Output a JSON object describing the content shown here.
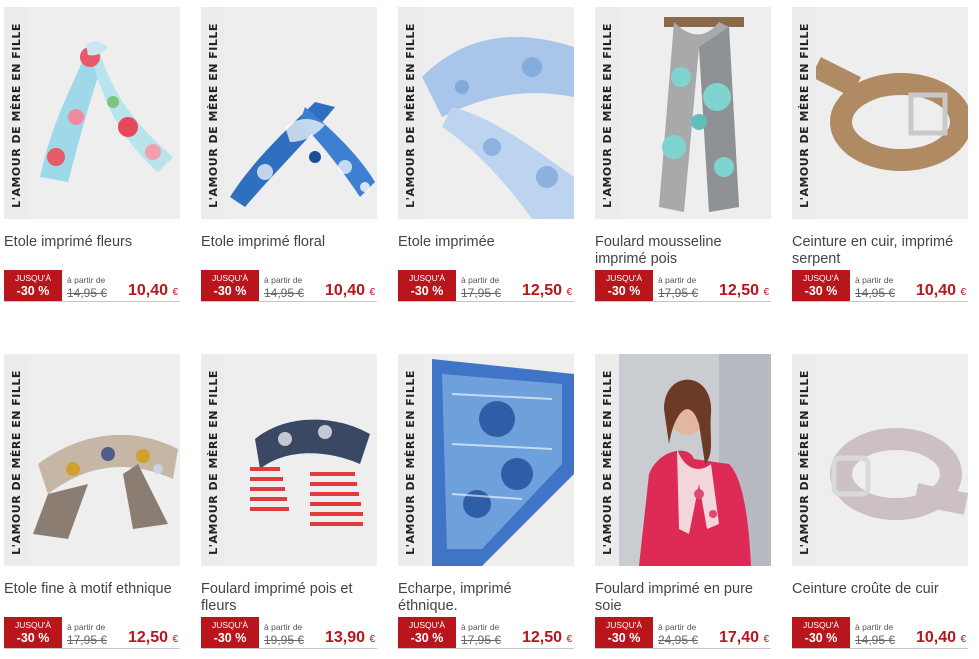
{
  "brand_text": "L'AMOUR DE MÈRE EN FILLE",
  "colors": {
    "accent": "#b8151d",
    "badge_text": "#ffffff",
    "card_bg": "#ececec"
  },
  "discount": {
    "line1": "JUSQU'À",
    "line2": "-30 %"
  },
  "from_label": "à partir de",
  "currency": "€",
  "products": [
    {
      "title": "Etole imprimé fleurs",
      "old_price": "14,95 €",
      "new_price": "10,40",
      "art": "scarf-floral-pink"
    },
    {
      "title": "Etole imprimé floral",
      "old_price": "14,95 €",
      "new_price": "10,40",
      "art": "scarf-floral-blue"
    },
    {
      "title": "Etole imprimée",
      "old_price": "17,95 €",
      "new_price": "12,50",
      "art": "scarf-light-blue"
    },
    {
      "title": "Foulard mousseline imprimé pois",
      "old_price": "17,95 €",
      "new_price": "12,50",
      "art": "scarf-dots-grey"
    },
    {
      "title": "Ceinture en cuir, imprimé serpent",
      "old_price": "14,95 €",
      "new_price": "10,40",
      "art": "belt-snake-brown"
    },
    {
      "title": "Etole fine à motif ethnique",
      "old_price": "17,95 €",
      "new_price": "12,50",
      "art": "scarf-ethnic-taupe"
    },
    {
      "title": "Foulard imprimé pois et fleurs",
      "old_price": "19,95 €",
      "new_price": "13,90",
      "art": "scarf-stripes-red-navy"
    },
    {
      "title": "Echarpe, imprimé éthnique.",
      "old_price": "17,95 €",
      "new_price": "12,50",
      "art": "scarf-ethnic-blue"
    },
    {
      "title": "Foulard imprimé en pure soie",
      "old_price": "24,95 €",
      "new_price": "17,40",
      "art": "model-pink-scarf"
    },
    {
      "title": "Ceinture croûte de cuir",
      "old_price": "14,95 €",
      "new_price": "10,40",
      "art": "belt-grey"
    }
  ]
}
